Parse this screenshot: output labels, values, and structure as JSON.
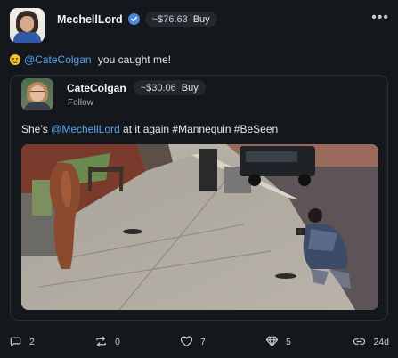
{
  "author": {
    "name": "MechellLord",
    "verified": true,
    "price": "~$76.63",
    "buy_label": "Buy",
    "more_label": "•••"
  },
  "post": {
    "emoji": "grinning-face",
    "mention": "@CateColgan",
    "text": " you caught me!"
  },
  "quote": {
    "name": "CateColgan",
    "price": "~$30.06",
    "buy_label": "Buy",
    "follow_label": "Follow",
    "text_pre": "She’s ",
    "mention": "@MechellLord",
    "text_post": " at it again #Mannequin #BeSeen",
    "photo": "street-photo"
  },
  "actions": {
    "replies": "2",
    "reposts": "0",
    "likes": "7",
    "tips": "5",
    "age": "24d"
  },
  "colors": {
    "background": "#14171c",
    "mention": "#5aa3f0",
    "verified": "#4a8bd9"
  }
}
